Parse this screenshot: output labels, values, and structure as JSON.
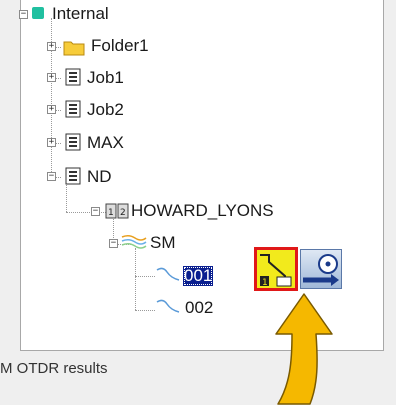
{
  "tree": {
    "root": {
      "label": "Internal"
    },
    "items": [
      {
        "label": "Folder1",
        "icon": "folder-icon"
      },
      {
        "label": "Job1",
        "icon": "job-icon"
      },
      {
        "label": "Job2",
        "icon": "job-icon"
      },
      {
        "label": "MAX",
        "icon": "job-icon"
      },
      {
        "label": "ND",
        "icon": "job-icon"
      }
    ],
    "cable": {
      "label": "HOWARD_LYONS",
      "icon": "cable-icon"
    },
    "fiber": {
      "label": "SM",
      "icon": "fiber-icon"
    },
    "traces": [
      {
        "label": "001",
        "selected": true
      },
      {
        "label": "002",
        "selected": false
      }
    ]
  },
  "toolbar": {
    "buttons": [
      {
        "name": "otdr-trace-button",
        "icon": "otdr-trace-icon",
        "highlighted": true
      },
      {
        "name": "analysis-button",
        "icon": "measurement-icon",
        "highlighted": false
      }
    ]
  },
  "caption": {
    "text": "M OTDR results"
  },
  "colors": {
    "selection": "#0a1f8f",
    "highlight_border": "#e01818",
    "otdr_icon": "#f2ea1c",
    "arrow": "#f5b800",
    "folder": "#f7cc3a",
    "root_icon": "#20c0a0"
  }
}
